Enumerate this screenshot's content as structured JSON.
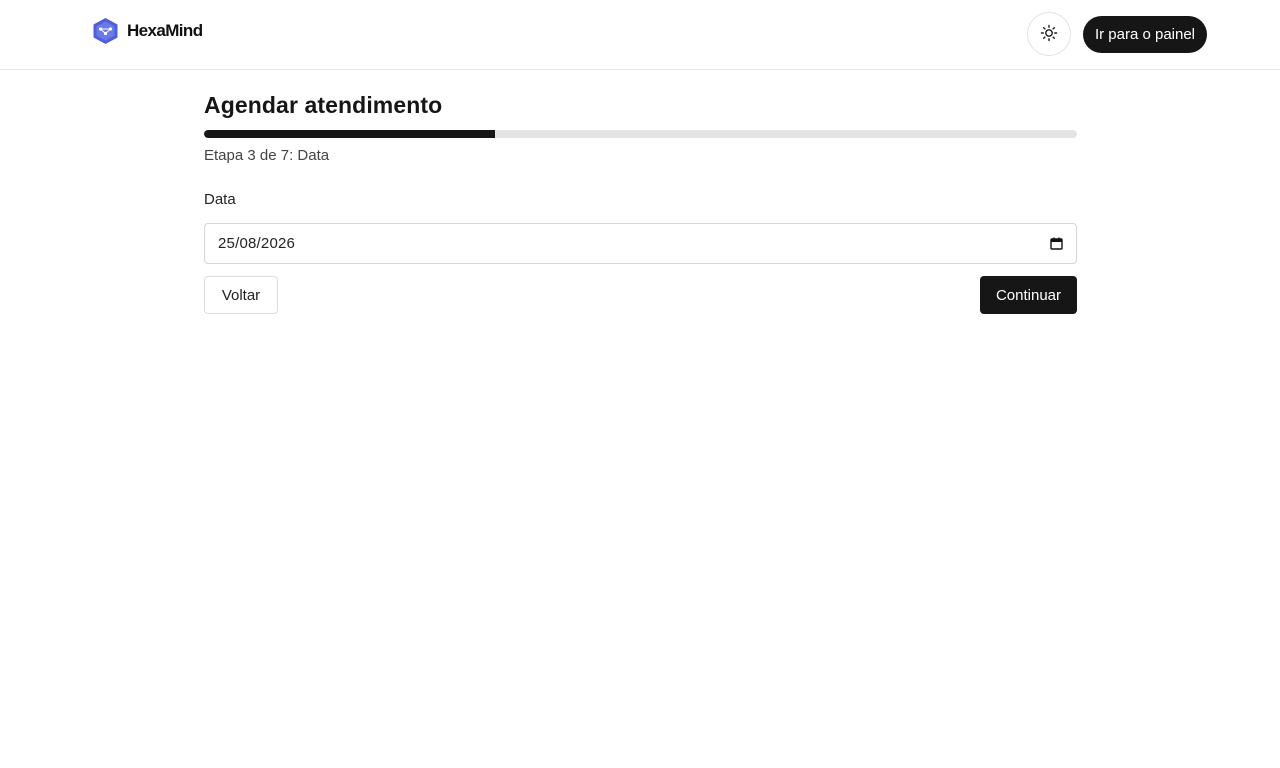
{
  "header": {
    "brand_name": "HexaMind",
    "logo_icon": "hexagon-network-icon",
    "theme_toggle_icon": "sun-icon",
    "dashboard_button_label": "Ir para o painel"
  },
  "wizard": {
    "title": "Agendar atendimento",
    "current_step": 3,
    "total_steps": 7,
    "progress_fraction": 0.333,
    "step_text": "Etapa 3 de 7: Data",
    "field_label": "Data",
    "date_value": "25/08/2026",
    "calendar_icon": "calendar-icon",
    "back_label": "Voltar",
    "continue_label": "Continuar"
  },
  "colors": {
    "primary": "#161616",
    "progress_track": "#e4e4e4",
    "logo_blue": "#4f5fd6"
  }
}
